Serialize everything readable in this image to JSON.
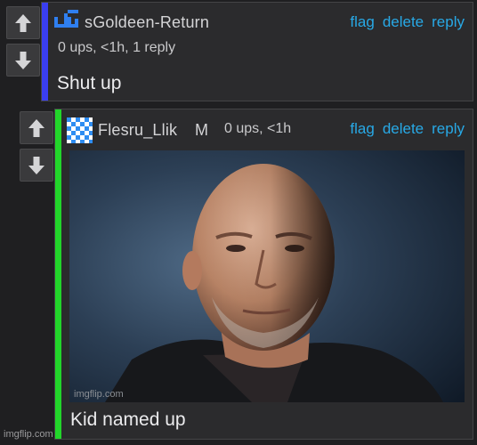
{
  "comments": [
    {
      "username": "sGoldeen-Return",
      "meta": "0 ups, <1h, 1 reply",
      "body": "Shut up",
      "accent_color": "#3a3ef0",
      "actions": [
        "flag",
        "delete",
        "reply"
      ],
      "avatar_icon": "blue-pixel-logo-icon"
    },
    {
      "username": "Flesru_Llik",
      "badge": "M",
      "meta": "0 ups, <1h",
      "body": "Kid named up",
      "accent_color": "#22d62a",
      "actions": [
        "flag",
        "delete",
        "reply"
      ],
      "avatar_icon": "blue-checker-avatar-icon",
      "image_watermark": "imgflip.com"
    }
  ],
  "vote_icons": {
    "up": "up-arrow-icon",
    "down": "down-arrow-icon"
  },
  "page_watermark": "imgflip.com",
  "colors": {
    "background": "#1f1f21",
    "card": "#2b2b2d",
    "link": "#28a9e6"
  }
}
